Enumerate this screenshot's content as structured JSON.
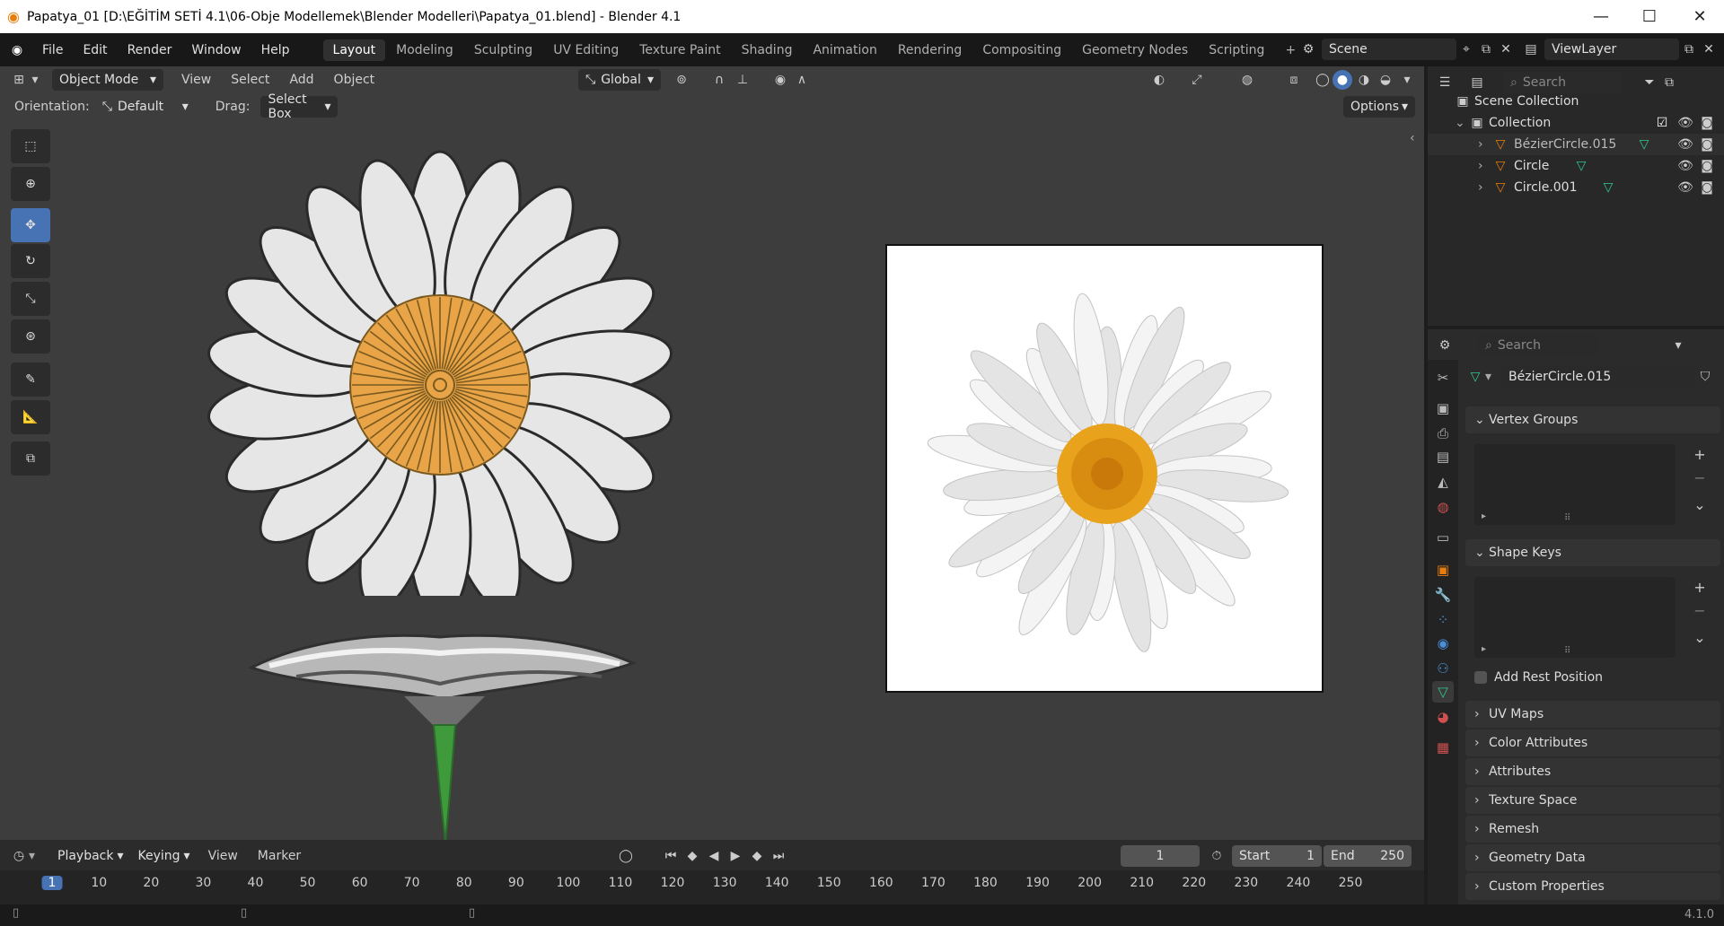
{
  "window": {
    "title": "Papatya_01 [D:\\EĞİTİM SETİ 4.1\\06-Obje Modellemek\\Blender Modelleri\\Papatya_01.blend] - Blender 4.1",
    "min_label": "—",
    "max_label": "☐",
    "close_label": "✕"
  },
  "menus": [
    "File",
    "Edit",
    "Render",
    "Window",
    "Help"
  ],
  "workspaces": [
    "Layout",
    "Modeling",
    "Sculpting",
    "UV Editing",
    "Texture Paint",
    "Shading",
    "Animation",
    "Rendering",
    "Compositing",
    "Geometry Nodes",
    "Scripting"
  ],
  "active_workspace": "Layout",
  "add_workspace_label": "+",
  "scene": {
    "name": "Scene",
    "viewlayer": "ViewLayer"
  },
  "viewport": {
    "mode": "Object Mode",
    "menus": [
      "View",
      "Select",
      "Add",
      "Object"
    ],
    "transform_orientation": "Global",
    "orientation_label": "Orientation:",
    "orientation_value": "Default",
    "drag_label": "Drag:",
    "drag_value": "Select Box",
    "options_label": "Options"
  },
  "tools": [
    "select-box-tool",
    "cursor-tool",
    "move-tool",
    "rotate-tool",
    "scale-tool",
    "transform-tool",
    "annotate-tool",
    "measure-tool",
    "add-cube-tool"
  ],
  "active_tool": "move-tool",
  "outliner": {
    "search_placeholder": "Search",
    "root": "Scene Collection",
    "collection": "Collection",
    "objects": [
      "BézierCircle.015",
      "Circle",
      "Circle.001"
    ]
  },
  "properties": {
    "search_placeholder": "Search",
    "object_name": "BézierCircle.015",
    "vertex_groups": "Vertex Groups",
    "shape_keys": "Shape Keys",
    "add_rest_position": "Add Rest Position",
    "panels": [
      "UV Maps",
      "Color Attributes",
      "Attributes",
      "Texture Space",
      "Remesh",
      "Geometry Data",
      "Custom Properties"
    ]
  },
  "timeline": {
    "menus": [
      "Playback",
      "Keying",
      "View",
      "Marker"
    ],
    "current_frame": "1",
    "start_label": "Start",
    "start_value": "1",
    "end_label": "End",
    "end_value": "250",
    "ruler": [
      "1",
      "10",
      "20",
      "30",
      "40",
      "50",
      "60",
      "70",
      "80",
      "90",
      "100",
      "110",
      "120",
      "130",
      "140",
      "150",
      "160",
      "170",
      "180",
      "190",
      "200",
      "210",
      "220",
      "230",
      "240",
      "250"
    ]
  },
  "status": {
    "version": "4.1.0"
  },
  "colors": {
    "accent": "#4772b3",
    "mesh_orange": "#e87d0d",
    "data_green": "#32c88c",
    "daisy_center": "#f0a83a"
  }
}
